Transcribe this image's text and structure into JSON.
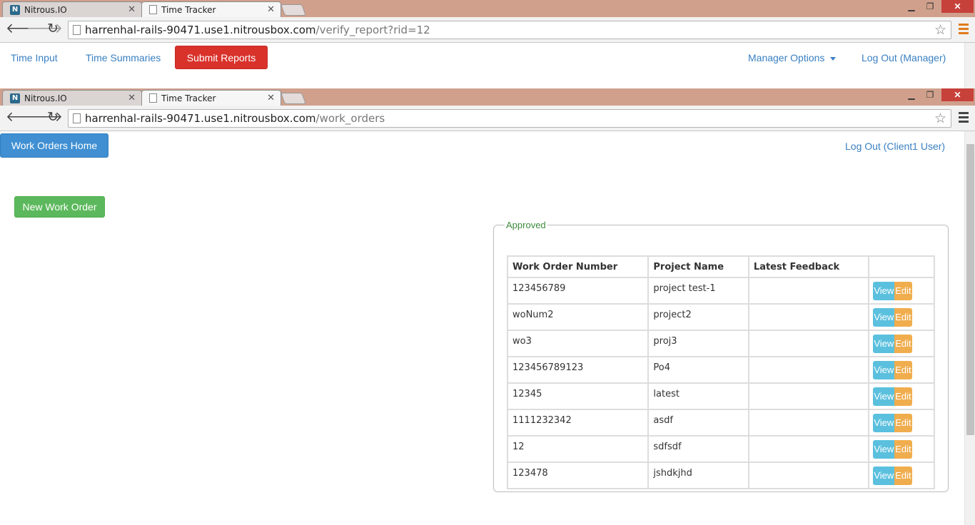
{
  "browser1": {
    "tabs": [
      {
        "label": "Nitrous.IO",
        "favicon": "N"
      },
      {
        "label": "Time Tracker"
      }
    ],
    "url_host": "harrenhal-rails-90471.use1.nitrousbox.com",
    "url_path": "/verify_report?rid=12"
  },
  "page1": {
    "nav": {
      "time_input": "Time Input",
      "time_summaries": "Time Summaries",
      "submit_reports": "Submit Reports",
      "manager_options": "Manager Options",
      "logout": "Log Out (Manager)"
    }
  },
  "browser2": {
    "tabs": [
      {
        "label": "Nitrous.IO",
        "favicon": "N"
      },
      {
        "label": "Time Tracker"
      }
    ],
    "url_host": "harrenhal-rails-90471.use1.nitrousbox.com",
    "url_path": "/work_orders"
  },
  "page2": {
    "home_button": "Work Orders Home",
    "logout": "Log Out (Client1 User)",
    "new_work_order": "New Work Order",
    "approved_legend": "Approved",
    "table": {
      "headers": [
        "Work Order Number",
        "Project Name",
        "Latest Feedback",
        ""
      ],
      "view_label": "View",
      "edit_label": "Edit",
      "rows": [
        {
          "number": "123456789",
          "project": "project test-1",
          "feedback": ""
        },
        {
          "number": "woNum2",
          "project": "project2",
          "feedback": ""
        },
        {
          "number": "wo3",
          "project": "proj3",
          "feedback": ""
        },
        {
          "number": "123456789123",
          "project": "Po4",
          "feedback": ""
        },
        {
          "number": "12345",
          "project": "latest",
          "feedback": ""
        },
        {
          "number": "1111232342",
          "project": "asdf",
          "feedback": ""
        },
        {
          "number": "12",
          "project": "sdfsdf",
          "feedback": ""
        },
        {
          "number": "123478",
          "project": "jshdkjhd",
          "feedback": ""
        }
      ]
    }
  },
  "colors": {
    "tabstrip": "#d0a08c",
    "primary_link": "#3a80c2",
    "danger": "#d9322b",
    "primary": "#3f8fd2",
    "success": "#5cb85c",
    "info": "#5bc0de",
    "warning": "#f0ad4e"
  }
}
